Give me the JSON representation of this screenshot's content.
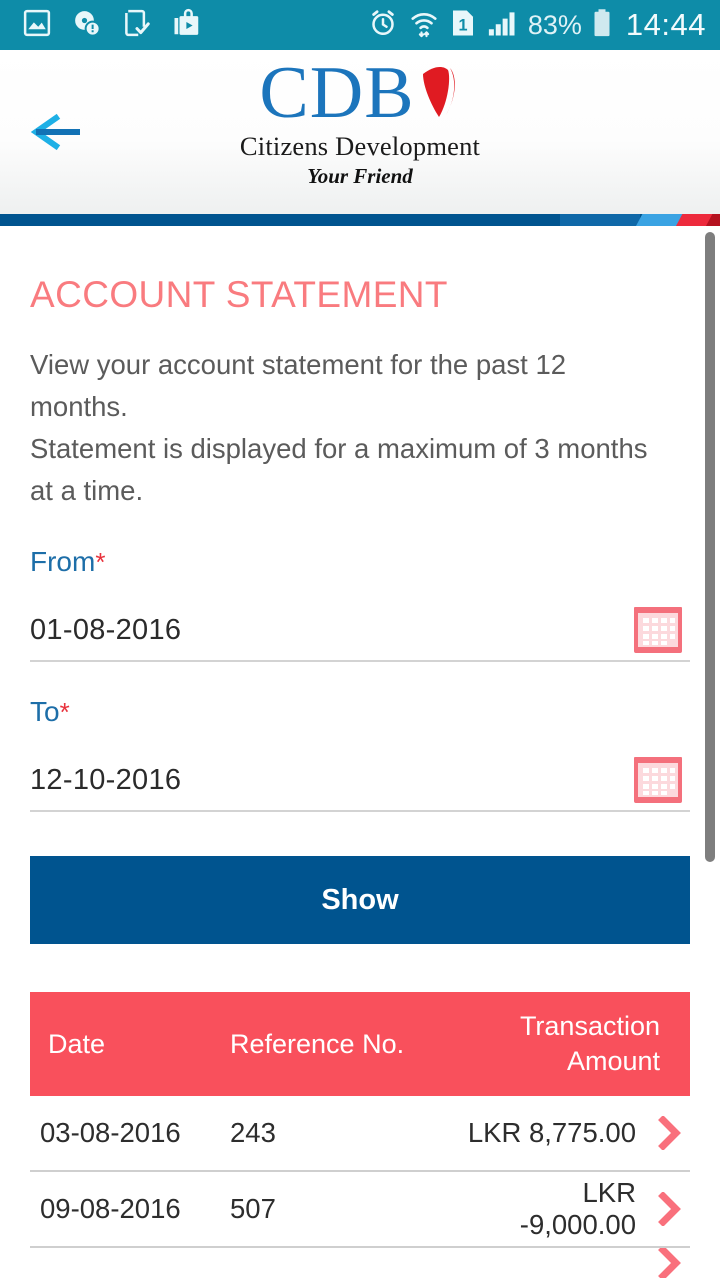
{
  "status_bar": {
    "background_color": "#0e8ca8",
    "notification_icons": [
      "photo-image-icon",
      "disc-info-icon",
      "phone-check-icon",
      "play-store-bag-icon"
    ],
    "system_icons": [
      "alarm-clock-icon",
      "wifi-transfer-icon",
      "sim-card-1-icon",
      "signal-bars-icon"
    ],
    "battery_percent": "83%",
    "time": "14:44"
  },
  "header": {
    "back_label": "back-arrow",
    "logo": {
      "letters": "CDB",
      "subtitle": "Citizens Development",
      "tagline": "Your Friend",
      "letters_color": "#1c75bc",
      "mark_color": "#e01b22"
    },
    "strip_colors": [
      "#00548f",
      "#0f68a8",
      "#3aa3e3",
      "#ed2a3c",
      "#b5121f"
    ]
  },
  "main": {
    "title": "ACCOUNT STATEMENT",
    "title_color": "#f97b7f",
    "description_line1": "View your account statement for the past 12 months.",
    "description_line2": "Statement is displayed for a maximum of 3 months at a time.",
    "from_field": {
      "label": "From",
      "required_marker": "*",
      "value": "01-08-2016",
      "calendar_icon": "calendar-icon"
    },
    "to_field": {
      "label": "To",
      "required_marker": "*",
      "value": "12-10-2016",
      "calendar_icon": "calendar-icon"
    },
    "show_button": {
      "label": "Show",
      "color": "#00548f"
    }
  },
  "table": {
    "header_color": "#f9505c",
    "columns": [
      "Date",
      "Reference No.",
      "Transaction Amount"
    ],
    "rows": [
      {
        "date": "03-08-2016",
        "reference": "243",
        "amount": "LKR 8,775.00",
        "chevron": "chevron-right-icon"
      },
      {
        "date": "09-08-2016",
        "reference": "507",
        "amount": "LKR -9,000.00",
        "chevron": "chevron-right-icon"
      }
    ]
  },
  "scrollbar": {
    "visible": true,
    "thumb_color": "#7e7e7e"
  }
}
